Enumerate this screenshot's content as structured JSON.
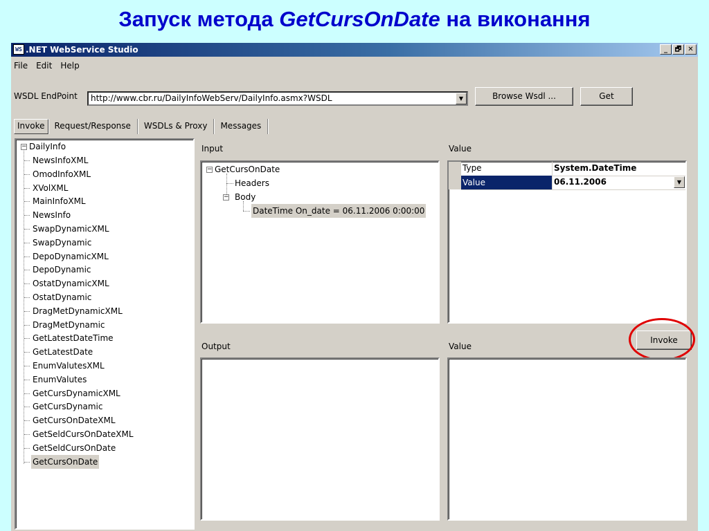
{
  "slide": {
    "title_prefix": "Запуск метода ",
    "title_method": "GetCursOnDate",
    "title_suffix": " на виконання"
  },
  "window": {
    "icon": "WS",
    "title": ".NET WebService Studio",
    "controls": [
      "_",
      "🗗",
      "✕"
    ]
  },
  "menu": [
    "File",
    "Edit",
    "Help"
  ],
  "wsdl": {
    "label": "WSDL EndPoint",
    "value": "http://www.cbr.ru/DailyInfoWebServ/DailyInfo.asmx?WSDL",
    "browse_label": "Browse Wsdl ...",
    "get_label": "Get"
  },
  "tabs": [
    "Invoke",
    "Request/Response",
    "WSDLs & Proxy",
    "Messages"
  ],
  "tree": {
    "root": "DailyInfo",
    "methods": [
      "NewsInfoXML",
      "OmodInfoXML",
      "XVolXML",
      "MainInfoXML",
      "NewsInfo",
      "SwapDynamicXML",
      "SwapDynamic",
      "DepoDynamicXML",
      "DepoDynamic",
      "OstatDynamicXML",
      "OstatDynamic",
      "DragMetDynamicXML",
      "DragMetDynamic",
      "GetLatestDateTime",
      "GetLatestDate",
      "EnumValutesXML",
      "EnumValutes",
      "GetCursDynamicXML",
      "GetCursDynamic",
      "GetCursOnDateXML",
      "GetSeldCursOnDateXML",
      "GetSeldCursOnDate",
      "GetCursOnDate"
    ]
  },
  "input": {
    "label": "Input",
    "root": "GetCursOnDate",
    "headers": "Headers",
    "body": "Body",
    "param": "DateTime On_date = 06.11.2006 0:00:00"
  },
  "value_top": {
    "label": "Value",
    "type_key": "Type",
    "type_value": "System.DateTime",
    "value_key": "Value",
    "value_value": "06.11.2006"
  },
  "invoke_label": "Invoke",
  "output": {
    "label": "Output"
  },
  "value_bottom": {
    "label": "Value"
  },
  "colors": {
    "slide_background": "#ccffff",
    "title_color": "#0000cc",
    "selection": "#0a246a",
    "highlight_circle": "#e00000"
  }
}
